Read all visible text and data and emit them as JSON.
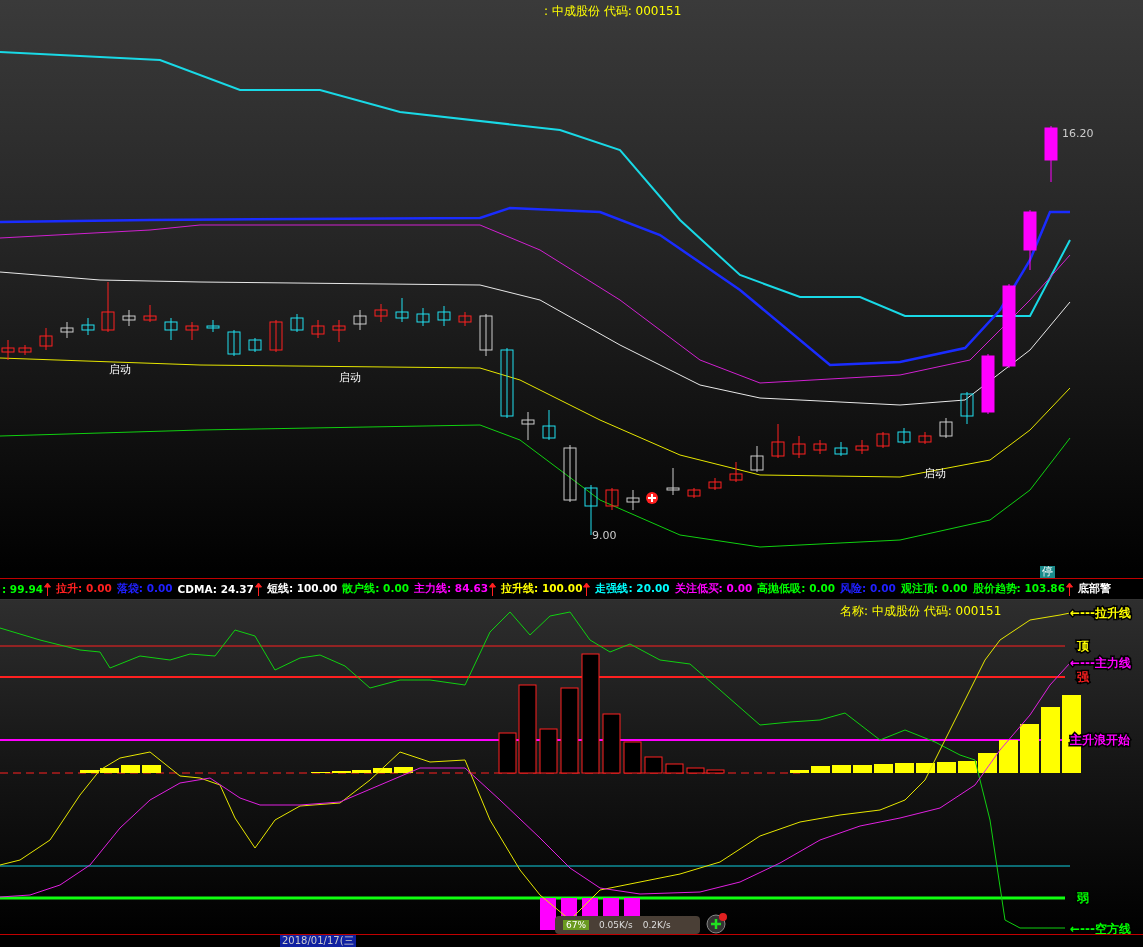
{
  "top_chart": {
    "title": ": 中成股份 代码: 000151",
    "markers": [
      {
        "text": "启动"
      },
      {
        "text": "启动"
      },
      {
        "text": "启动"
      }
    ],
    "high_label": "16.20",
    "low_label": "9.00",
    "halt_badge": "停"
  },
  "indicator_bar": [
    {
      "text": ": 99.94",
      "color": "#00ff00",
      "up_arrow": true
    },
    {
      "text": "拉升: 0.00",
      "color": "#ff2020",
      "up_arrow": false
    },
    {
      "text": "落袋: 0.00",
      "color": "#2020ff",
      "up_arrow": false
    },
    {
      "text": "CDMA: 24.37",
      "color": "#ffffff",
      "up_arrow": true
    },
    {
      "text": "短线: 100.00",
      "color": "#ffffff",
      "up_arrow": false
    },
    {
      "text": "散户线: 0.00",
      "color": "#00ff00",
      "up_arrow": false
    },
    {
      "text": "主力线: 84.63",
      "color": "#ff00ff",
      "up_arrow": true
    },
    {
      "text": "拉升线: 100.00",
      "color": "#ffff00",
      "up_arrow": true
    },
    {
      "text": "走强线: 20.00",
      "color": "#00ffff",
      "up_arrow": false
    },
    {
      "text": "关注低买: 0.00",
      "color": "#ff00ff",
      "up_arrow": false
    },
    {
      "text": "高抛低吸: 0.00",
      "color": "#00ff00",
      "up_arrow": false
    },
    {
      "text": "风险: 0.00",
      "color": "#2020ff",
      "up_arrow": false
    },
    {
      "text": "观注顶: 0.00",
      "color": "#00ff00",
      "up_arrow": false
    },
    {
      "text": "股价趋势: 103.86",
      "color": "#00ff00",
      "up_arrow": true
    },
    {
      "text": "底部警",
      "color": "#ffffff",
      "up_arrow": false
    }
  ],
  "lower_chart": {
    "title": "名称: 中成股份 代码: 000151",
    "line_labels": [
      {
        "text": "←---拉升线",
        "color": "#ffff00"
      },
      {
        "text": "顶",
        "color": "#ffff00"
      },
      {
        "text": "←---主力线",
        "color": "#ff00ff"
      },
      {
        "text": "强",
        "color": "#ff2020"
      },
      {
        "text": "主升浪开始",
        "color": "#ff00ff"
      },
      {
        "text": "弱",
        "color": "#00ff00"
      },
      {
        "text": "←---空方线",
        "color": "#00ff00"
      }
    ]
  },
  "time_axis": {
    "date": "2018/01/17(三"
  },
  "network_widget": {
    "usage": "67%",
    "upload": "0.05K/s",
    "download": "0.2K/s"
  }
}
